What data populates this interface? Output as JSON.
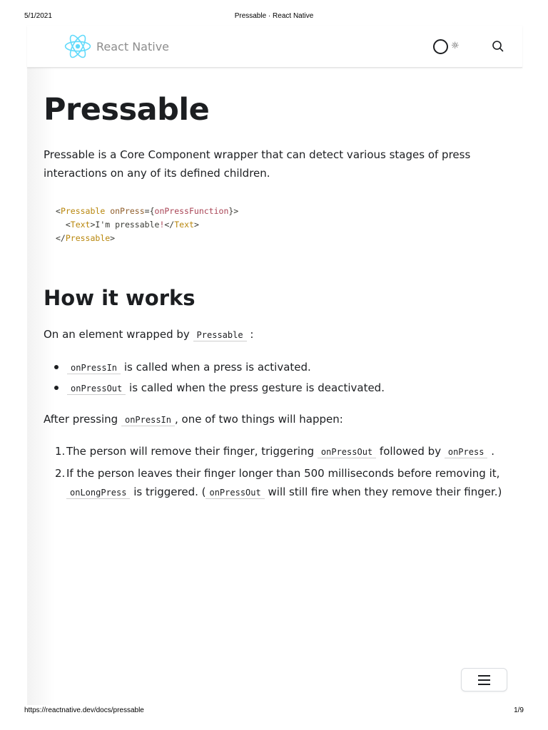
{
  "print": {
    "date": "5/1/2021",
    "title": "Pressable · React Native",
    "url": "https://reactnative.dev/docs/pressable",
    "page": "1/9"
  },
  "nav": {
    "brand": "React Native",
    "logo_icon": "react-atom-icon",
    "theme_icon": "sun-icon",
    "search_icon": "magnifier-icon"
  },
  "article": {
    "title": "Pressable",
    "intro": "Pressable is a Core Component wrapper that can detect various stages of press interactions on any of its defined children.",
    "code": {
      "l1_open": "<",
      "l1_tag": "Pressable",
      "l1_attr": "onPress",
      "l1_eq": "={",
      "l1_fn": "onPressFunction",
      "l1_close": "}>",
      "l2_open": "  <",
      "l2_tag": "Text",
      "l2_gt": ">",
      "l2_text": "I'm pressable",
      "l2_bang": "!",
      "l2_close_open": "</",
      "l2_close_tag": "Text",
      "l2_close_gt": ">",
      "l3_open": "</",
      "l3_tag": "Pressable",
      "l3_gt": ">"
    },
    "section_title": "How it works",
    "wrapped_prefix": "On an element wrapped by",
    "wrapped_code": "Pressable",
    "wrapped_suffix": ":",
    "bullets": [
      {
        "code": "onPressIn",
        "text": "is called when a press is activated."
      },
      {
        "code": "onPressOut",
        "text": "is called when the press gesture is deactivated."
      }
    ],
    "after_prefix": "After pressing",
    "after_code": "onPressIn",
    "after_suffix": ", one of two things will happen:",
    "steps": {
      "s1_num": "1.",
      "s1_text": "The person will remove their finger, triggering",
      "s1_code1": "onPressOut",
      "s1_mid": "followed by",
      "s1_code2": "onPress",
      "s1_end": ".",
      "s2_num": "2.",
      "s2_text": "If the person leaves their finger longer than 500 milliseconds before removing it,",
      "s2_code1": "onLongPress",
      "s2_mid": "is triggered. (",
      "s2_code2": "onPressOut",
      "s2_end": "will still fire when they remove their finger.)"
    }
  },
  "menu_icon": "hamburger-menu-icon",
  "colors": {
    "react_blue": "#61dafb",
    "text": "#1c1e21",
    "brand_text": "#8d8d8d"
  }
}
